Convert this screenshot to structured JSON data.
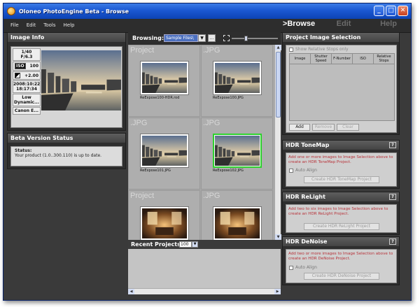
{
  "window": {
    "title": "Oloneo PhotoEngine Beta - Browse",
    "buttons": {
      "minimize": "_",
      "maximize": "□",
      "close": "✕"
    }
  },
  "menu": [
    "File",
    "Edit",
    "Tools",
    "Help"
  ],
  "nav_tabs": [
    {
      "label": ">Browse",
      "active": true
    },
    {
      "label": "Edit",
      "active": false
    },
    {
      "label": "Help",
      "active": false
    }
  ],
  "image_info": {
    "title": "Image Info",
    "exposure": "1/40",
    "aperture": "F/6.3",
    "iso_icon": "ISO",
    "iso_value": "100",
    "ev_value": "+2.00",
    "date": "2008:10:22",
    "time": "18:17:34",
    "dynamic": "Low Dynamic...",
    "camera": "Canon E..."
  },
  "beta_status": {
    "title": "Beta Version Status",
    "status_label": "Status:",
    "message": "Your product (1.0..300.110) is up to date."
  },
  "browse": {
    "label": "Browsing:",
    "folder": "Sample Files\\",
    "dropdown_glyph": "▼",
    "browse_button": "...",
    "tiles": [
      {
        "type": "Project",
        "name": "ReExpose100-HDR.rod",
        "selected": false
      },
      {
        "type": ".JPG",
        "name": "ReExpose100.JPG",
        "selected": false
      },
      {
        "type": ".JPG",
        "name": "ReExpose101.JPG",
        "selected": false
      },
      {
        "type": ".JPG",
        "name": "ReExpose102.JPG",
        "selected": true
      },
      {
        "type": "Project",
        "name": "",
        "selected": false
      },
      {
        "type": ".JPG",
        "name": "",
        "selected": false
      }
    ]
  },
  "recent": {
    "label": "Recent Projects:",
    "count": "100",
    "dropdown_glyph": "▼"
  },
  "scroll_glyphs": {
    "up": "▲",
    "down": "▼",
    "left": "◀",
    "right": "▶"
  },
  "project_selection": {
    "title": "Project Image Selection",
    "show_relative": "Show Relative Stops only",
    "columns": [
      "Image",
      "Shutter Speed",
      "F-Number",
      "ISO",
      "Relative Stops"
    ],
    "buttons": {
      "add": "Add",
      "remove": "Remove",
      "clear": "Clear"
    }
  },
  "tonemap": {
    "title": "HDR ToneMap",
    "help": "?",
    "message": "Add one or more images to Image Selection above to create an HDR ToneMap Project.",
    "auto_align": "Auto Align",
    "create": "Create HDR ToneMap Project"
  },
  "relight": {
    "title": "HDR ReLight",
    "help": "?",
    "message": "Add two to six images to Image Selection above to create an HDR ReLight Project.",
    "create": "Create HDR ReLight Project"
  },
  "denoise": {
    "title": "HDR DeNoise",
    "help": "?",
    "message": "Add two or more images to Image Selection above to create an HDR DeNoise Project.",
    "auto_align": "Auto Align",
    "create": "Create HDR DeNoise Project"
  },
  "colors": {
    "titlebar": "#1b58d2",
    "selection_border": "#2ed12e",
    "warning_text": "#b8333a"
  }
}
